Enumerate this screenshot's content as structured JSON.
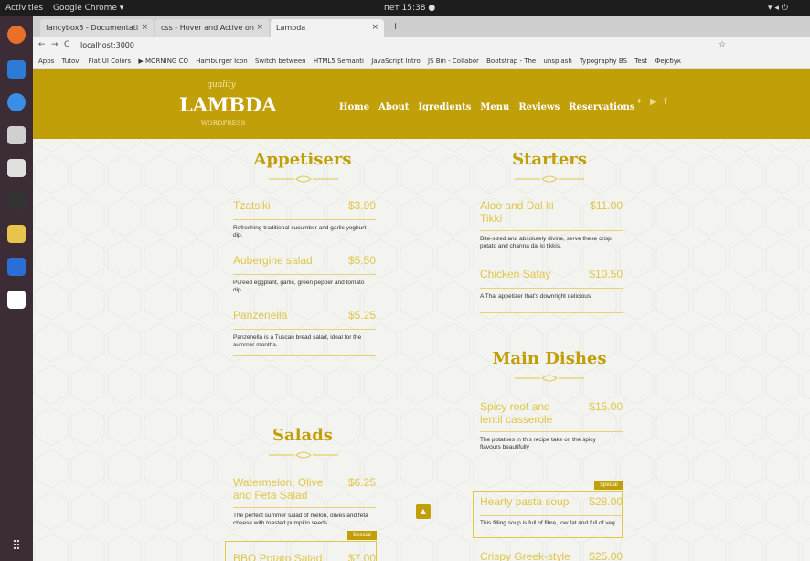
{
  "os": {
    "activities": "Activities",
    "app": "Google Chrome ▾",
    "clock": "пет 15:38 ●"
  },
  "browser": {
    "tabs": [
      {
        "label": "fancybox3 - Documentati"
      },
      {
        "label": "css - Hover and Active on"
      },
      {
        "label": "Lambda"
      }
    ],
    "address": "localhost:3000",
    "bookmarks": [
      "Apps",
      "Tutovi",
      "Flat UI Colors",
      "▶ MORNING CO",
      "Hamburger Icon",
      "Switch between",
      "HTML5 Semanti",
      "JavaScript Intro",
      "JS Bin - Collabor",
      "Bootstrap - The",
      "unsplash",
      "Typography BS",
      "Test",
      "Фејсбук"
    ]
  },
  "site": {
    "logo_top": "quality",
    "logo": "LAMBDA",
    "logo_sub": "WORDPRESS",
    "nav": [
      "Home",
      "About",
      "Igredients",
      "Menu",
      "Reviews",
      "Reservations"
    ],
    "appetisers": {
      "title": "Appetisers",
      "items": [
        {
          "name": "Tzatsiki",
          "price": "$3.99",
          "desc": "Refreshing traditional cucumber and garlic yoghurt dip."
        },
        {
          "name": "Aubergine salad",
          "price": "$5.50",
          "desc": "Pureed eggplant, garlic, green pepper and tomato dip."
        },
        {
          "name": "Panzenella",
          "price": "$5.25",
          "desc": "Panzenella is a Tuscan bread salad, ideal for the summer months."
        }
      ]
    },
    "starters": {
      "title": "Starters",
      "items": [
        {
          "name": "Aloo and Dal ki Tikki",
          "price": "$11.00",
          "desc": "Bite-sized and absolutely divine, serve these crisp potato and channa dal ki tikkis."
        },
        {
          "name": "Chicken Satay",
          "price": "$10.50",
          "desc": "A Thai appetizer that's downright delicious"
        }
      ]
    },
    "salads": {
      "title": "Salads",
      "items": [
        {
          "name": "Watermelon, Olive and Feta Salad",
          "price": "$6.25",
          "desc": "The perfect summer salad of melon, olives and feta cheese with toasted pumpkin seeds."
        },
        {
          "name": "BBQ Potato Salad",
          "price": "$7.00"
        }
      ],
      "special": "Special"
    },
    "main": {
      "title": "Main Dishes",
      "items": [
        {
          "name": "Spicy root and lentil casserole",
          "price": "$15.00",
          "desc": "The potatoes in this recipe take on the spicy flavours beautifully"
        },
        {
          "name": "Hearty pasta soup",
          "price": "$28.00",
          "desc": "This filling soup is full of fibre, low fat and full of veg"
        },
        {
          "name": "Crispy Greek-style pie",
          "price": "$25.00"
        }
      ],
      "special": "Special"
    }
  }
}
